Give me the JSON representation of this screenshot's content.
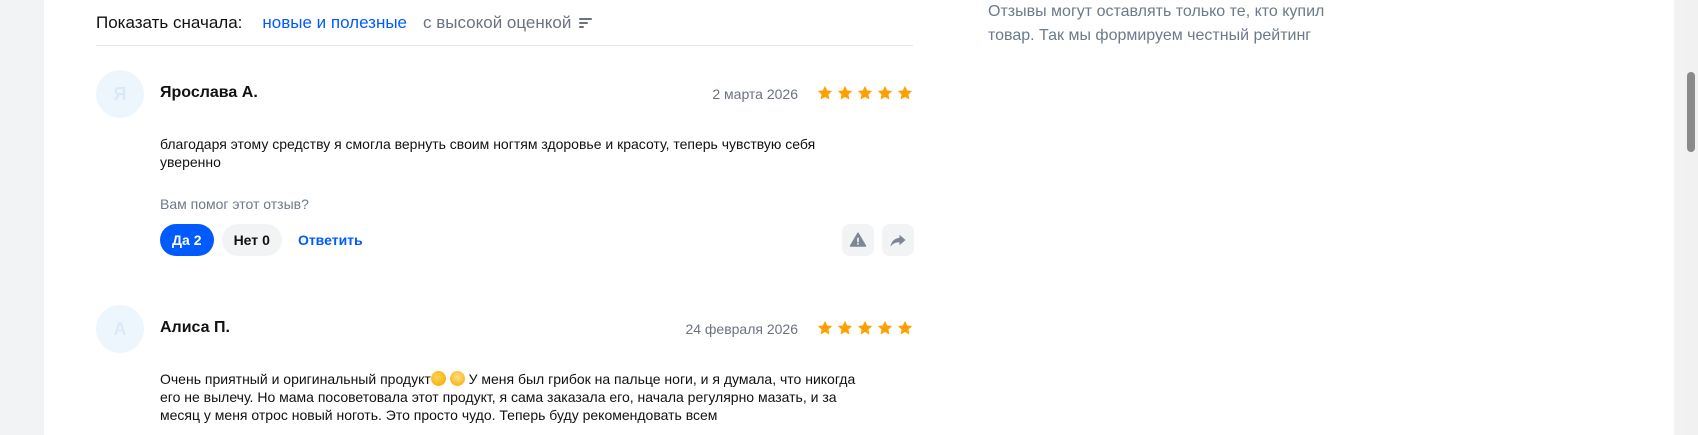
{
  "sort": {
    "label": "Показать сначала:",
    "option_active": "новые и полезные",
    "option_other": "с высокой оценкой"
  },
  "side_note": "Отзывы могут оставлять только те, кто купил товар. Так мы формируем честный рейтинг",
  "reviews": [
    {
      "avatar_letter": "Я",
      "author": "Ярослава А.",
      "date": "2 марта 2026",
      "rating": 5,
      "text": "благодаря этому средству я смогла вернуть своим ногтям здоровье и красоту, теперь чувствую себя уверенно",
      "helpful_question": "Вам помог этот отзыв?",
      "yes_label": "Да",
      "yes_count": "2",
      "no_label": "Нет",
      "no_count": "0",
      "reply_label": "Ответить"
    },
    {
      "avatar_letter": "А",
      "author": "Алиса П.",
      "date": "24 февраля 2026",
      "rating": 5,
      "text_part1": "Очень приятный и оригинальный продукт",
      "text_part2": " У меня был грибок на пальце ноги, и я думала, что никогда его не вылечу. Но мама посоветовала этот продукт, я сама заказала его, начала регулярно мазать, и за месяц у меня отрос новый ноготь. Это просто чудо. Теперь буду рекомендовать всем",
      "emojis": [
        "clapping-hands-emoji",
        "smiling-face-emoji"
      ]
    }
  ],
  "colors": {
    "accent": "#005bff",
    "star": "#ffa000",
    "muted": "#6b7280"
  }
}
